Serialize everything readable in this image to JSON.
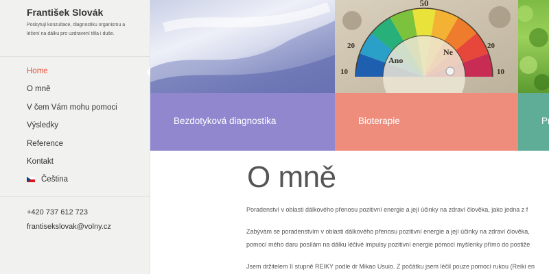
{
  "site": {
    "title": "František Slovák",
    "description": "Poskytuji konzultace, diagnostiku organismu a léčení na dálku pro uzdravení těla i duše."
  },
  "nav": {
    "items": [
      {
        "label": "Home",
        "active": true
      },
      {
        "label": "O mně"
      },
      {
        "label": "V čem Vám mohu pomoci"
      },
      {
        "label": "Výsledky"
      },
      {
        "label": "Reference"
      },
      {
        "label": "Kontakt"
      },
      {
        "label": "Čeština",
        "icon": "czech-flag-icon"
      }
    ]
  },
  "contact": {
    "phone": "+420 737 612 723",
    "email": "frantisekslovak@volny.cz"
  },
  "tiles": [
    {
      "label": "Bezdotyková diagnostika",
      "color": "#9187cf"
    },
    {
      "label": "Bioterapie",
      "color": "#ef8d7d"
    },
    {
      "label": "Pr",
      "color": "#60ad97"
    }
  ],
  "chart_labels": {
    "top_number": "50",
    "left_word": "Ano",
    "right_word": "Ne",
    "left_number": "20",
    "right_number": "20",
    "bottom_left": "10",
    "bottom_right": "10"
  },
  "main": {
    "title": "O mně",
    "paragraphs": [
      "Poradenství v oblasti dálkového přenosu pozitivní energie a její účinky na zdraví člověka, jako jedna z f",
      "Zabývám se poradenstvím v oblasti dálkového přenosu pozitivní energie a její účinky na zdraví člověka,",
      "pomocí mého daru posílám na dálku léčivé impulsy pozitivní energie pomocí myšlenky přímo do postiže",
      "Jsem držitelem II stupně REIKY podle dr Mikao Usuio. Z počátku jsem léčil pouze pomocí rukou (Reiki en"
    ]
  }
}
